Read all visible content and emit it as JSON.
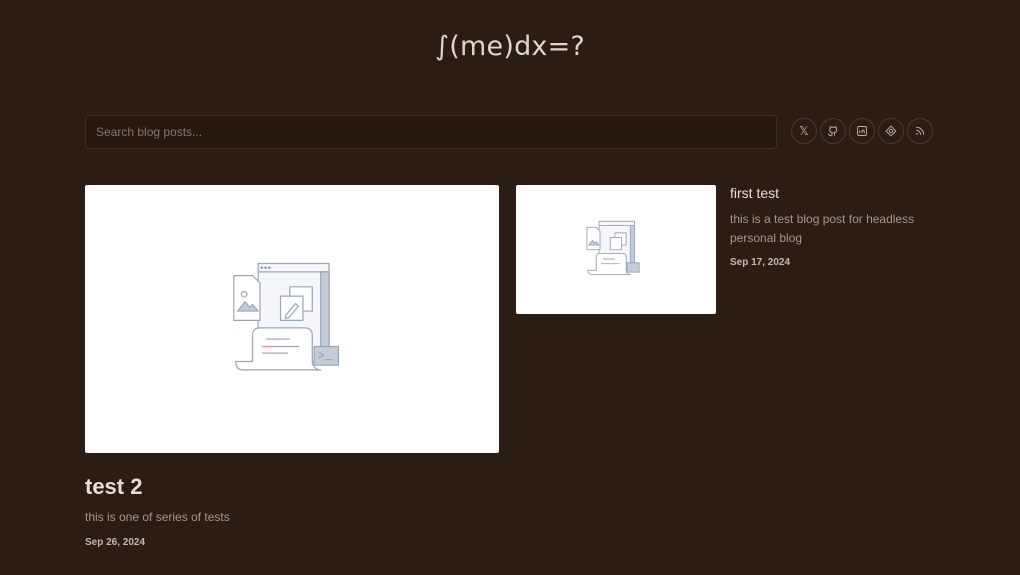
{
  "site": {
    "title": "∫(me)dx=?"
  },
  "search": {
    "placeholder": "Search blog posts..."
  },
  "social": [
    {
      "icon": "x-icon",
      "glyph": "𝕏"
    },
    {
      "icon": "github-icon"
    },
    {
      "icon": "linkedin-icon"
    },
    {
      "icon": "devto-icon"
    },
    {
      "icon": "rss-icon"
    }
  ],
  "posts": [
    {
      "title": "test 2",
      "description": "this is one of series of tests",
      "date": "Sep 26, 2024"
    },
    {
      "title": "first test",
      "description": "this is a test blog post for headless personal blog",
      "date": "Sep 17, 2024"
    }
  ],
  "colors": {
    "background": "#2b1d13",
    "card": "#ffffff",
    "illustration": "#9aa5b8"
  }
}
